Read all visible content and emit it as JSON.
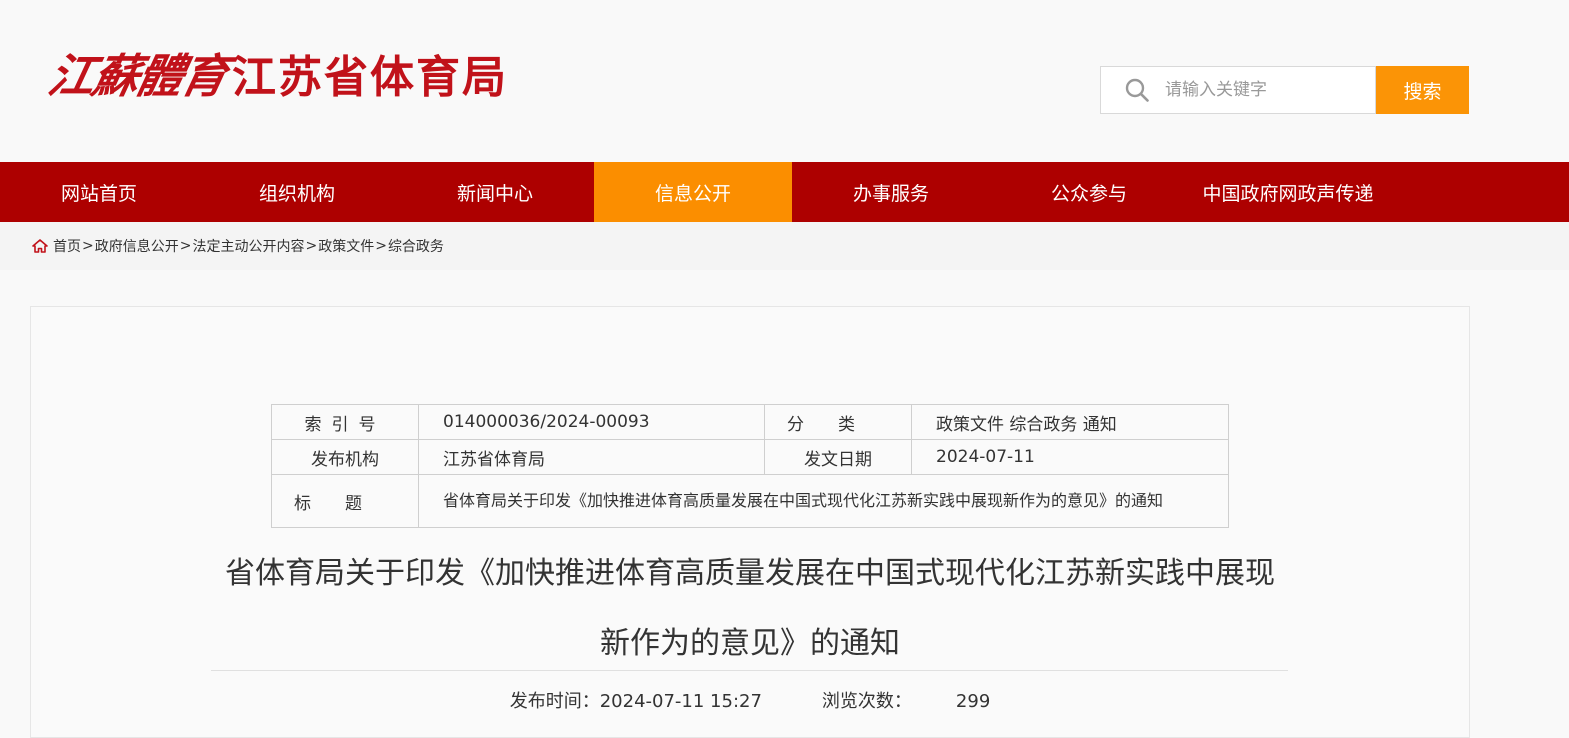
{
  "header": {
    "logo_calligraphy": "江蘇體育",
    "logo_text": "江苏省体育局"
  },
  "search": {
    "placeholder": "请输入关键字",
    "button_label": "搜索"
  },
  "nav": {
    "items": [
      {
        "label": "网站首页"
      },
      {
        "label": "组织机构"
      },
      {
        "label": "新闻中心"
      },
      {
        "label": "信息公开",
        "active": true
      },
      {
        "label": "办事服务"
      },
      {
        "label": "公众参与"
      },
      {
        "label": "中国政府网政声传递"
      }
    ]
  },
  "breadcrumb": {
    "items": [
      "首页",
      "政府信息公开",
      "法定主动公开内容",
      "政策文件",
      "综合政务"
    ],
    "separator": ">"
  },
  "meta": {
    "index_label": "索引号",
    "index_value": "014000036/2024-00093",
    "category_label": "分类",
    "category_value": "政策文件 综合政务 通知",
    "publisher_label": "发布机构",
    "publisher_value": "江苏省体育局",
    "date_label": "发文日期",
    "date_value": "2024-07-11",
    "title_label": "标题",
    "title_value": "省体育局关于印发《加快推进体育高质量发展在中国式现代化江苏新实践中展现新作为的意见》的通知"
  },
  "article": {
    "title_line1": "省体育局关于印发《加快推进体育高质量发展在中国式现代化江苏新实践中展现",
    "title_line2": "新作为的意见》的通知",
    "publish_label": "发布时间：",
    "publish_time": "2024-07-11 15:27",
    "views_label": "浏览次数：",
    "views_count": "299"
  },
  "colors": {
    "brand_red": "#ad0000",
    "logo_red": "#c1121a",
    "accent_orange": "#fb9406"
  }
}
